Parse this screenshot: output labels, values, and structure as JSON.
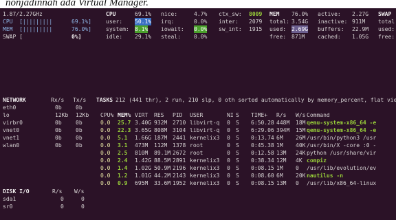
{
  "caption": "nonjadinnah ada Virtual Manager.",
  "top_section": {
    "lines": [
      {
        "c1": "1.87/2.27GHz",
        "c2": "CPU",
        "c3": "69.1%",
        "c4": "nice:",
        "c5": "4.7%",
        "c6": "ctx_sw:",
        "c7": "8009",
        "c8": "MEM",
        "c9": "76.0%",
        "c10": "active:",
        "c11": "2.27G",
        "c12": "SWAP"
      },
      {
        "c1": "CPU  [|||||||||",
        "c1b": "69.1%]",
        "c2": "user:",
        "c3": "50.1%",
        "c4": "irq:",
        "c5": "0.0%",
        "c6": "inter:",
        "c7": "2079",
        "c8": "total:",
        "c9": "3.54G",
        "c10": "inactive:",
        "c11": "911M",
        "c12": "total"
      },
      {
        "c1": "MEM  [|||||||||",
        "c1b": "76.0%]",
        "c2": "system:",
        "c3": "8.1%",
        "c4": "iowait:",
        "c5": "0.0%",
        "c6": "sw_int:",
        "c7": "1915",
        "c8": "used:",
        "c9": "2.69G",
        "c10": "buffers:",
        "c11": "22.9M",
        "c12": "used:"
      },
      {
        "c1": "SWAP [",
        "c1b": "0%]",
        "c2": "idle:",
        "c3": "29.1%",
        "c4": "steal:",
        "c5": "0.0%",
        "c6": "",
        "c7": "",
        "c8": "free:",
        "c9": "871M",
        "c10": "cached:",
        "c11": "1.05G",
        "c12": "free:"
      }
    ]
  },
  "network": {
    "header": [
      "NETWORK",
      "Rx/s",
      "Tx/s"
    ],
    "rows": [
      [
        "eth0",
        "0b",
        "0b"
      ],
      [
        "lo",
        "12Kb",
        "12Kb"
      ],
      [
        "virbr0",
        "0b",
        "0b"
      ],
      [
        "vnet0",
        "0b",
        "0b"
      ],
      [
        "vnet1",
        "0b",
        "0b"
      ],
      [
        "wlan0",
        "0b",
        "0b"
      ]
    ]
  },
  "disk": {
    "header": [
      "DISK I/O",
      "R/s",
      "W/s"
    ],
    "rows": [
      [
        "sda1",
        "0",
        "0"
      ],
      [
        "sr0",
        "0",
        "0"
      ]
    ]
  },
  "tasks": {
    "summary_label": "TASKS",
    "summary_text": "212 (441 thr), 2 run, 210 slp, 0 oth sorted automatically by memory_percent, flat vie",
    "columns": [
      "CPU%",
      "MEM%",
      "VIRT",
      "RES",
      "PID",
      "USER",
      "NI",
      "S",
      "TIME+",
      "R/s",
      "W/s",
      "Command"
    ],
    "rows": [
      [
        "0.0",
        "25.7",
        "3.40G",
        "932M",
        "2710",
        "libvirt-q",
        "0",
        "S",
        "6:50.28",
        "448M",
        "18M",
        "qemu-system-x86_64 -e"
      ],
      [
        "0.0",
        "22.3",
        "3.65G",
        "808M",
        "3104",
        "libvirt-q",
        "0",
        "S",
        "6:29.06",
        "394M",
        "15M",
        "qemu-system-x86_64 -e"
      ],
      [
        "0.0",
        "5.1",
        "1.66G",
        "187M",
        "2441",
        "kernelix3",
        "0",
        "S",
        "0:13.74",
        "6M",
        "26M",
        "/usr/bin/python3 /usr"
      ],
      [
        "0.0",
        "3.1",
        "473M",
        "112M",
        "1378",
        "root",
        "0",
        "S",
        "0:45.38",
        "1M",
        "40K",
        "/usr/bin/X -core :0 -"
      ],
      [
        "0.0",
        "2.5",
        "810M",
        "89.1M",
        "2672",
        "root",
        "0",
        "S",
        "0:12.58",
        "13M",
        "24K",
        "python /usr/share/vir"
      ],
      [
        "0.0",
        "2.4",
        "1.42G",
        "88.5M",
        "2891",
        "kernelix3",
        "0",
        "S",
        "0:38.34",
        "12M",
        "4K",
        "compiz"
      ],
      [
        "0.0",
        "1.4",
        "1.02G",
        "50.9M",
        "2196",
        "kernelix3",
        "0",
        "S",
        "0:08.15",
        "1M",
        "0",
        "/usr/lib/evolution/ev"
      ],
      [
        "0.0",
        "1.2",
        "1.01G",
        "44.2M",
        "2143",
        "kernelix3",
        "0",
        "S",
        "0:08.60",
        "6M",
        "20K",
        "nautilus -n"
      ],
      [
        "0.0",
        "0.9",
        "695M",
        "33.6M",
        "1952",
        "kernelix3",
        "0",
        "S",
        "0:08.15",
        "13M",
        "0",
        "/usr/lib/x86_64-linux"
      ]
    ]
  }
}
